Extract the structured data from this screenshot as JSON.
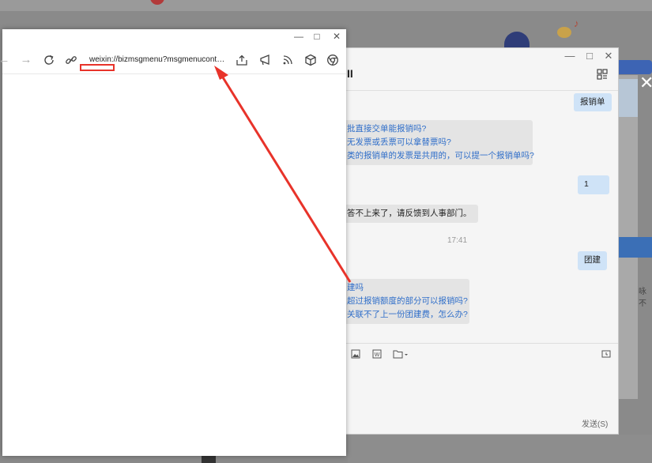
{
  "background": {
    "side_text": "咏不"
  },
  "chat": {
    "title": "II",
    "window_buttons": [
      "—",
      "□",
      "✕"
    ],
    "messages": {
      "m1": "报销单",
      "m2_lines": [
        "批直接交单能报销吗?",
        "无发票或丢票可以拿替票吗?",
        "类的报销单的发票是共用的，可以提一个报销单吗?"
      ],
      "m3": "1",
      "m4": "答不上来了，请反馈到人事部门。",
      "time": "17:41",
      "m5": "团建",
      "m6_lines": [
        "建吗",
        "超过报销额度的部分可以报销吗?",
        "关联不了上一份团建费，怎么办?"
      ]
    },
    "toolbar_icons": [
      "image-icon",
      "word-icon",
      "folder-icon",
      "screenshot-icon"
    ],
    "send_label": "发送(S)"
  },
  "browser": {
    "window_buttons": [
      "—",
      "□",
      "✕"
    ],
    "url": "weixin://bizmsgmenu?msgmenucontent=",
    "nav_icons": [
      "back-icon",
      "forward-icon",
      "refresh-icon",
      "link-icon"
    ],
    "toolbar_icons": [
      "share-icon",
      "feedback-icon",
      "rss-icon",
      "cube-icon",
      "chrome-icon"
    ]
  },
  "colors": {
    "annotation_red": "#e8332a",
    "link_blue": "#2f6ec9",
    "bubble_blue": "#cfe3f7"
  }
}
